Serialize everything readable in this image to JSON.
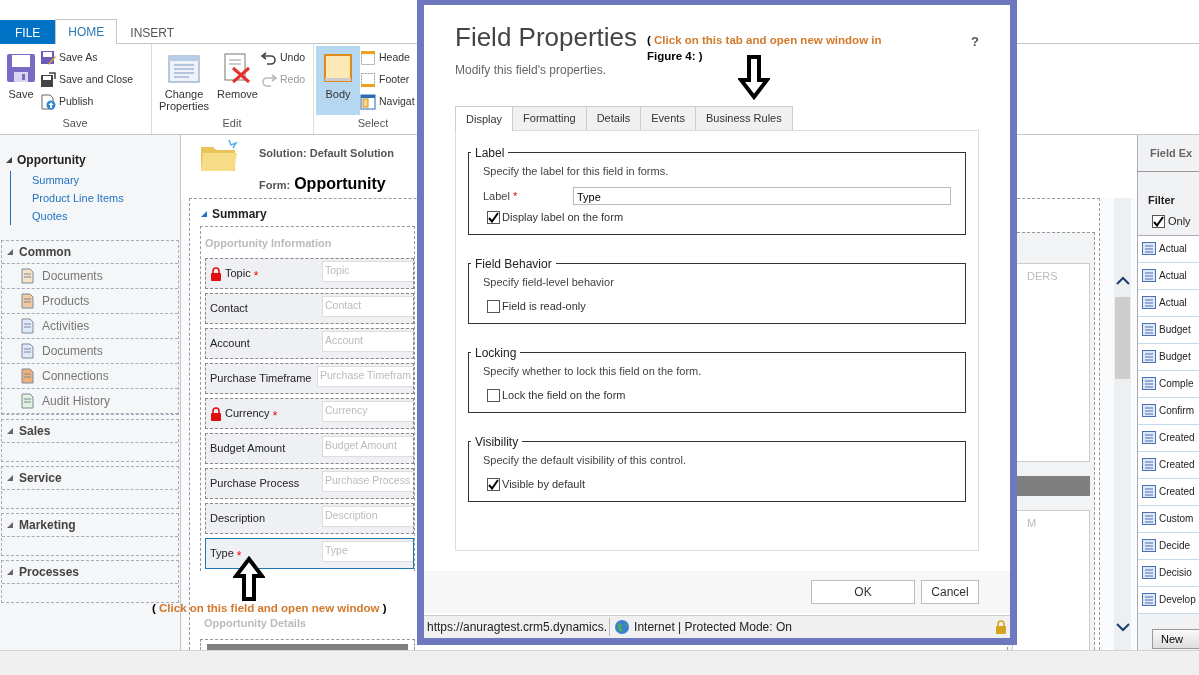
{
  "ribbon": {
    "tabs": [
      {
        "label": "FILE",
        "kind": "file",
        "selected": false
      },
      {
        "label": "HOME",
        "kind": "tab",
        "selected": true
      },
      {
        "label": "INSERT",
        "kind": "tab",
        "selected": false
      }
    ],
    "groups": [
      {
        "label": "Save",
        "large": [
          {
            "label": "Save"
          }
        ],
        "small": [
          {
            "label": "Save As"
          },
          {
            "label": "Save and Close"
          },
          {
            "label": "Publish"
          }
        ]
      },
      {
        "label": "Edit",
        "large": [
          {
            "label": "Change Properties",
            "disabled": false
          },
          {
            "label": "Remove",
            "disabled": false
          }
        ],
        "small": [
          {
            "label": "Undo",
            "disabled": false
          },
          {
            "label": "Redo",
            "disabled": true
          }
        ]
      },
      {
        "label": "Select",
        "large": [
          {
            "label": "Body",
            "selected": true
          }
        ],
        "small": [
          {
            "label": "Heade",
            "selected": false
          },
          {
            "label": "Footer",
            "selected": false
          },
          {
            "label": "Navigat",
            "selected": false
          }
        ]
      }
    ]
  },
  "nav": {
    "entity": "Opportunity",
    "links": [
      "Summary",
      "Product Line Items",
      "Quotes"
    ],
    "groups": [
      {
        "title": "Common",
        "items": [
          "Documents",
          "Products",
          "Activities",
          "Documents",
          "Connections",
          "Audit History"
        ]
      },
      {
        "title": "Sales"
      },
      {
        "title": "Service"
      },
      {
        "title": "Marketing"
      },
      {
        "title": "Processes"
      }
    ]
  },
  "form": {
    "solution": "Solution: Default Solution",
    "form_label": "Form:",
    "form_name": "Opportunity",
    "section": "Summary",
    "subsection": "Opportunity Information",
    "fields": [
      {
        "label": "Topic",
        "locked": true,
        "required_mark": "*",
        "placeholder": "Topic",
        "selected": false
      },
      {
        "label": "Contact",
        "locked": false,
        "placeholder": "Contact",
        "selected": false
      },
      {
        "label": "Account",
        "locked": false,
        "placeholder": "Account",
        "selected": false
      },
      {
        "label": "Purchase Timeframe",
        "locked": false,
        "placeholder": "Purchase Timefram",
        "selected": false
      },
      {
        "label": "Currency",
        "locked": true,
        "required_mark": "*",
        "placeholder": "Currency",
        "selected": false
      },
      {
        "label": "Budget Amount",
        "locked": false,
        "placeholder": "Budget Amount",
        "selected": false
      },
      {
        "label": "Purchase Process",
        "locked": false,
        "placeholder": "Purchase Process",
        "selected": false
      },
      {
        "label": "Description",
        "locked": false,
        "placeholder": "Description",
        "selected": false
      },
      {
        "label": "Type",
        "locked": false,
        "required_mark": "*",
        "placeholder": "Type",
        "selected": true
      }
    ],
    "details_heading": "Opportunity Details",
    "side_labels": [
      "DERS",
      "M"
    ]
  },
  "annotations": [
    {
      "parts": [
        {
          "text": "(",
          "kind": "bracket"
        },
        {
          "text": "Click on this field and open new window",
          "kind": "note"
        },
        {
          "text": ")",
          "kind": "bracket"
        }
      ]
    },
    {
      "parts": [
        {
          "text": "(",
          "kind": "bracket"
        },
        {
          "text": "Click on this tab and open new window in",
          "kind": "note"
        },
        {
          "text": "Figure 4: )",
          "kind": "figure"
        }
      ]
    }
  ],
  "dialog": {
    "title": "Field Properties",
    "subtitle": "Modify this field's properties.",
    "help": "?",
    "tabs": [
      {
        "label": "Display",
        "selected": true
      },
      {
        "label": "Formatting",
        "selected": false
      },
      {
        "label": "Details",
        "selected": false
      },
      {
        "label": "Events",
        "selected": false
      },
      {
        "label": "Business Rules",
        "selected": false
      }
    ],
    "sections": [
      {
        "title": "Label",
        "description": "Specify the label for this field in forms.",
        "field": {
          "label": "Label",
          "required_mark": "*",
          "value": "Type"
        },
        "checkbox": {
          "label": "Display label on the form",
          "checked": true
        }
      },
      {
        "title": "Field Behavior",
        "description": "Specify field-level behavior",
        "checkbox": {
          "label": "Field is read-only",
          "checked": false
        }
      },
      {
        "title": "Locking",
        "description": "Specify whether to lock this field on the form.",
        "checkbox": {
          "label": "Lock the field on the form",
          "checked": false
        }
      },
      {
        "title": "Visibility",
        "description": "Specify the default visibility of this control.",
        "checkbox": {
          "label": "Visible by default",
          "checked": true
        }
      }
    ],
    "buttons": [
      "OK",
      "Cancel"
    ],
    "status": {
      "url": "https://anuragtest.crm5.dynamics.",
      "zone": "Internet | Protected Mode: On"
    }
  },
  "explorer": {
    "title": "Field Ex",
    "filter_label": "Filter",
    "filter_option": {
      "label": "Only",
      "checked": true
    },
    "fields": [
      "Actual",
      "Actual",
      "Actual",
      "Budget",
      "Budget",
      "Comple",
      "Confirm",
      "Created",
      "Created",
      "Created",
      "Custom",
      "Decide",
      "Decisio",
      "Develop"
    ],
    "button": "New"
  }
}
